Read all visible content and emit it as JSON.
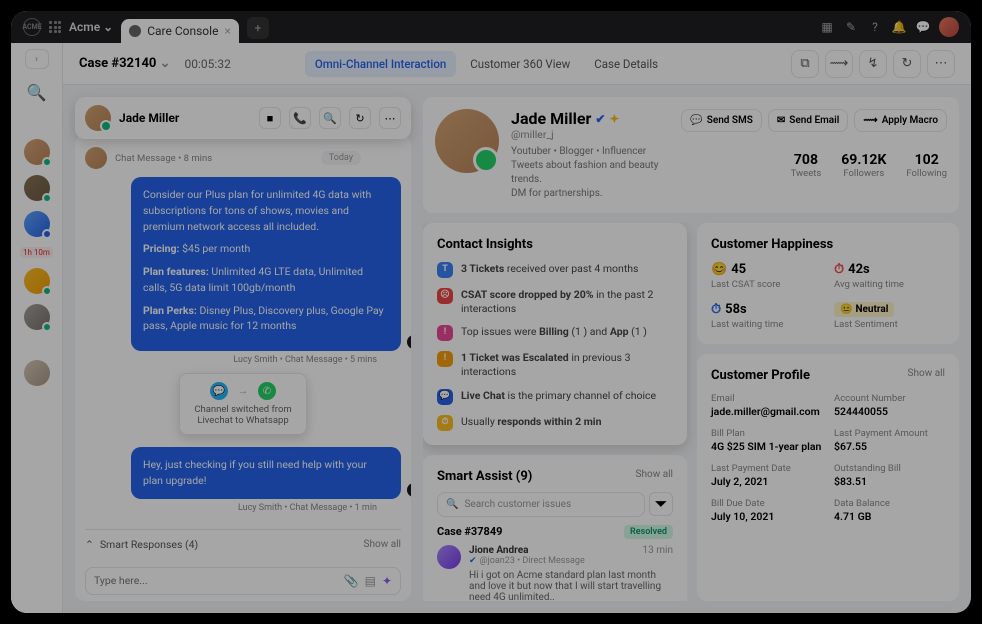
{
  "topbar": {
    "workspace": "Acme",
    "tab": "Care Console"
  },
  "header": {
    "case": "Case #32140",
    "timer": "00:05:32",
    "tabs": [
      "Omni-Channel Interaction",
      "Customer 360 View",
      "Case Details"
    ]
  },
  "leftrail_time": "1h 10m",
  "chat": {
    "name": "Jade Miller",
    "meta1": "Chat Message • 8 mins",
    "today": "Today",
    "msg1_lines": [
      "Consider our Plus plan for unlimited 4G data with subscriptions for tons of shows, movies and premium network access all included.",
      "Pricing: $45 per month",
      "Plan features: Unlimited 4G LTE data, Unlimited calls, 5G data limit 100gb/month",
      "Plan Perks: Disney Plus, Discovery plus, Google Pay pass, Apple music for 12 months"
    ],
    "msg1_pricing_label": "Pricing:",
    "msg1_pricing_val": " $45 per month",
    "msg1_features_label": "Plan features:",
    "msg1_features_val": " Unlimited 4G LTE data, Unlimited calls, 5G data limit 100gb/month",
    "msg1_perks_label": "Plan Perks:",
    "msg1_perks_val": " Disney Plus, Discovery plus, Google Pay pass, Apple music for 12 months",
    "msg1_intro": "Consider our Plus plan for unlimited 4G data with subscriptions for tons of shows, movies and premium network access all included.",
    "msgmeta1": "Lucy Smith • Chat Message • 5 mins",
    "switch_arrow": "→",
    "switch1": "Channel switched from",
    "switch2": "Livechat to Whatsapp",
    "msg2": "Hey, just checking if you still need help with your plan upgrade!",
    "msgmeta2": "Lucy Smith • Chat Message • 1 min",
    "smartresp": "Smart Responses (4)",
    "smartresp_showall": "Show all",
    "input_ph": "Type here..."
  },
  "contact": {
    "name": "Jade Miller",
    "handle": "@miller_j",
    "bio1": "Youtuber • Blogger • Influencer",
    "bio2": "Tweets about fashion and beauty trends.",
    "bio3": "DM for partnerships.",
    "btn_sms": "Send SMS",
    "btn_email": "Send Email",
    "btn_macro": "Apply Macro",
    "stats": [
      {
        "num": "708",
        "lbl": "Tweets"
      },
      {
        "num": "69.12K",
        "lbl": "Followers"
      },
      {
        "num": "102",
        "lbl": "Following"
      }
    ]
  },
  "insights": {
    "title": "Contact Insights",
    "rows": [
      {
        "ico": "T",
        "color": "#3b82f6",
        "bold1": "3 Tickets",
        "rest": " received over past 4 months"
      },
      {
        "ico": "☹",
        "color": "#ef4444",
        "bold1": "CSAT score dropped by 20%",
        "rest": " in the past 2 interactions"
      },
      {
        "ico": "!",
        "color": "#ec4899",
        "pre": "Top issues were ",
        "bold1": "Billing",
        "mid": " (1 ) and ",
        "bold2": "App",
        "rest": " (1 )"
      },
      {
        "ico": "!",
        "color": "#f59e0b",
        "bold1": "1 Ticket was Escalated",
        "rest": " in previous 3 interactions"
      },
      {
        "ico": "💬",
        "color": "#2563eb",
        "bold1": "Live Chat",
        "rest": " is the primary channel of choice"
      },
      {
        "ico": "⏱",
        "color": "#fbbf24",
        "pre": "Usually ",
        "bold1": "responds within 2 min",
        "rest": ""
      }
    ]
  },
  "smartassist": {
    "title": "Smart Assist (9)",
    "showall": "Show all",
    "search_ph": "Search customer issues",
    "case": "Case #37849",
    "resolved": "Resolved",
    "time": "13 min",
    "author": "Jione Andrea",
    "author_handle": "@joan23 • Direct Message",
    "body": "Hi i got on Acme standard plan last month and love it but now that I will start travelling need 4G unlimited.."
  },
  "happiness": {
    "title": "Customer Happiness",
    "metrics": [
      {
        "icon": "😊",
        "color": "#f59e0b",
        "val": "45",
        "lbl": "Last CSAT score"
      },
      {
        "icon": "⏱",
        "color": "#ef4444",
        "val": "42s",
        "lbl": "Avg waiting time"
      },
      {
        "icon": "⏱",
        "color": "#2563eb",
        "val": "58s",
        "lbl": "Last waiting time"
      },
      {
        "icon": "😐",
        "color": "#fbbf24",
        "val": "Neutral",
        "lbl": "Last Sentiment",
        "neutral": true
      }
    ]
  },
  "profile": {
    "title": "Customer Profile",
    "showall": "Show all",
    "fields": [
      {
        "lbl": "Email",
        "val": "jade.miller@gmail.com"
      },
      {
        "lbl": "Account Number",
        "val": "524440055"
      },
      {
        "lbl": "Bill Plan",
        "val": "4G $25 SIM 1-year plan"
      },
      {
        "lbl": "Last Payment Amount",
        "val": "$67.55"
      },
      {
        "lbl": "Last Payment Date",
        "val": "July 2, 2021"
      },
      {
        "lbl": "Outstanding Bill",
        "val": "$83.51"
      },
      {
        "lbl": "Bill Due Date",
        "val": "July 10, 2021"
      },
      {
        "lbl": "Data Balance",
        "val": "4.71 GB"
      }
    ]
  }
}
